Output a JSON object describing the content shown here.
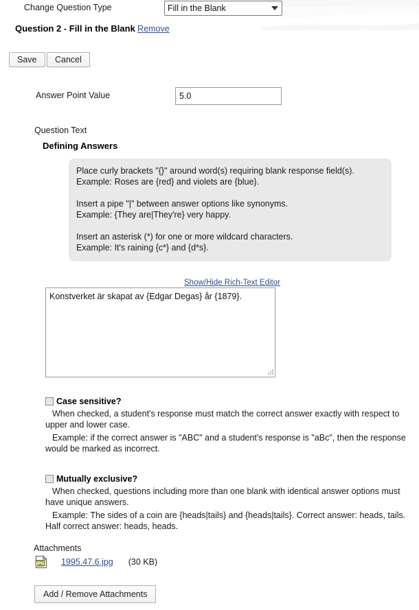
{
  "header": {
    "change_type_label": "Change Question Type",
    "question_type_selected": "Fill in the Blank",
    "question_type_options": [
      "Fill in the Blank"
    ],
    "question_title": "Question 2",
    "question_dash": " - ",
    "question_type_name": "Fill in the Blank",
    "remove_link": "Remove"
  },
  "toolbar": {
    "save_label": "Save",
    "cancel_label": "Cancel"
  },
  "point_value": {
    "label": "Answer Point Value",
    "value": "5.0"
  },
  "question_text": {
    "label": "Question Text",
    "defining_answers_label": "Defining Answers"
  },
  "instructions": {
    "p1_line1": "Place curly brackets \"{}\" around word(s) requiring blank response field(s).",
    "p1_line2": "Example: Roses are {red} and violets are {blue}.",
    "p2_line1": "Insert a pipe \"|\" between answer options like synonyms.",
    "p2_line2": "Example: {They are|They're} very happy.",
    "p3_line1": "Insert an asterisk (*) for one or more wildcard characters.",
    "p3_line2": "Example: It's raining {c*} and {d*s}."
  },
  "editor": {
    "rte_toggle_label": "Show/Hide Rich-Text Editor",
    "textarea_value": "Konstverket är skapat av {Edgar Degas} år {1879}.",
    "textarea_placeholder": ""
  },
  "options": {
    "case_sensitive": {
      "title": "Case sensitive?",
      "checked": false,
      "description": "When checked, a student's response must match the correct answer exactly with respect to upper and lower case.",
      "example": "Example: if the correct answer is \"ABC\" and a student's response is \"aBc\", then the response would be marked as incorrect."
    },
    "mutually_exclusive": {
      "title": "Mutually exclusive?",
      "checked": false,
      "description": "When checked, questions including more than one blank with identical answer options must have unique answers.",
      "example": "Example: The sides of a coin are {heads|tails} and {heads|tails}. Correct answer: heads, tails. Half correct answer: heads, heads."
    }
  },
  "attachments": {
    "label": "Attachments",
    "file_name": "1995.47.6.jpg",
    "file_size": "(30 KB)",
    "file_icon": "jpg-file-icon",
    "file_icon_text": "JPG",
    "add_remove_label": "Add / Remove Attachments"
  },
  "colors": {
    "link": "#2d4f8f",
    "panel_bg": "#e9e9e9",
    "page_bg": "#ffffff",
    "icon_yellow": "#9c9c24"
  }
}
